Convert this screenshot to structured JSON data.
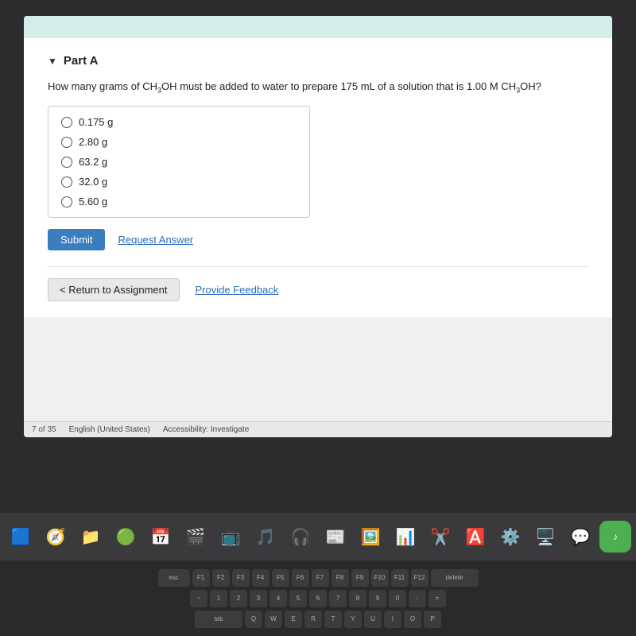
{
  "screen": {
    "top_bar_color": "#d4ede8"
  },
  "part": {
    "label": "Part A",
    "collapse_icon": "▼"
  },
  "question": {
    "text_before": "How many grams of CH",
    "subscript1": "3",
    "text_middle": "OH must be added to water to prepare 175 mL of a solution that is 1.00 M CH",
    "subscript2": "3",
    "text_end": "OH?"
  },
  "options": [
    {
      "id": "opt1",
      "label": "0.175 g"
    },
    {
      "id": "opt2",
      "label": "2.80 g"
    },
    {
      "id": "opt3",
      "label": "63.2 g"
    },
    {
      "id": "opt4",
      "label": "32.0 g"
    },
    {
      "id": "opt5",
      "label": "5.60 g"
    }
  ],
  "actions": {
    "submit_label": "Submit",
    "request_answer_label": "Request Answer"
  },
  "navigation": {
    "return_label": "< Return to Assignment",
    "feedback_label": "Provide Feedback"
  },
  "status_bar": {
    "page": "7 of 35",
    "language": "English (United States)",
    "accessibility": "Accessibility: Investigate"
  },
  "dock": {
    "icons": [
      "🟦",
      "🧭",
      "📁",
      "🟢",
      "📅",
      "🎬",
      "📺",
      "🎵",
      "🎧",
      "📰",
      "🖼️",
      "📊",
      "✂️",
      "🅰️",
      "⚙️",
      "🖥️",
      "💬"
    ]
  }
}
